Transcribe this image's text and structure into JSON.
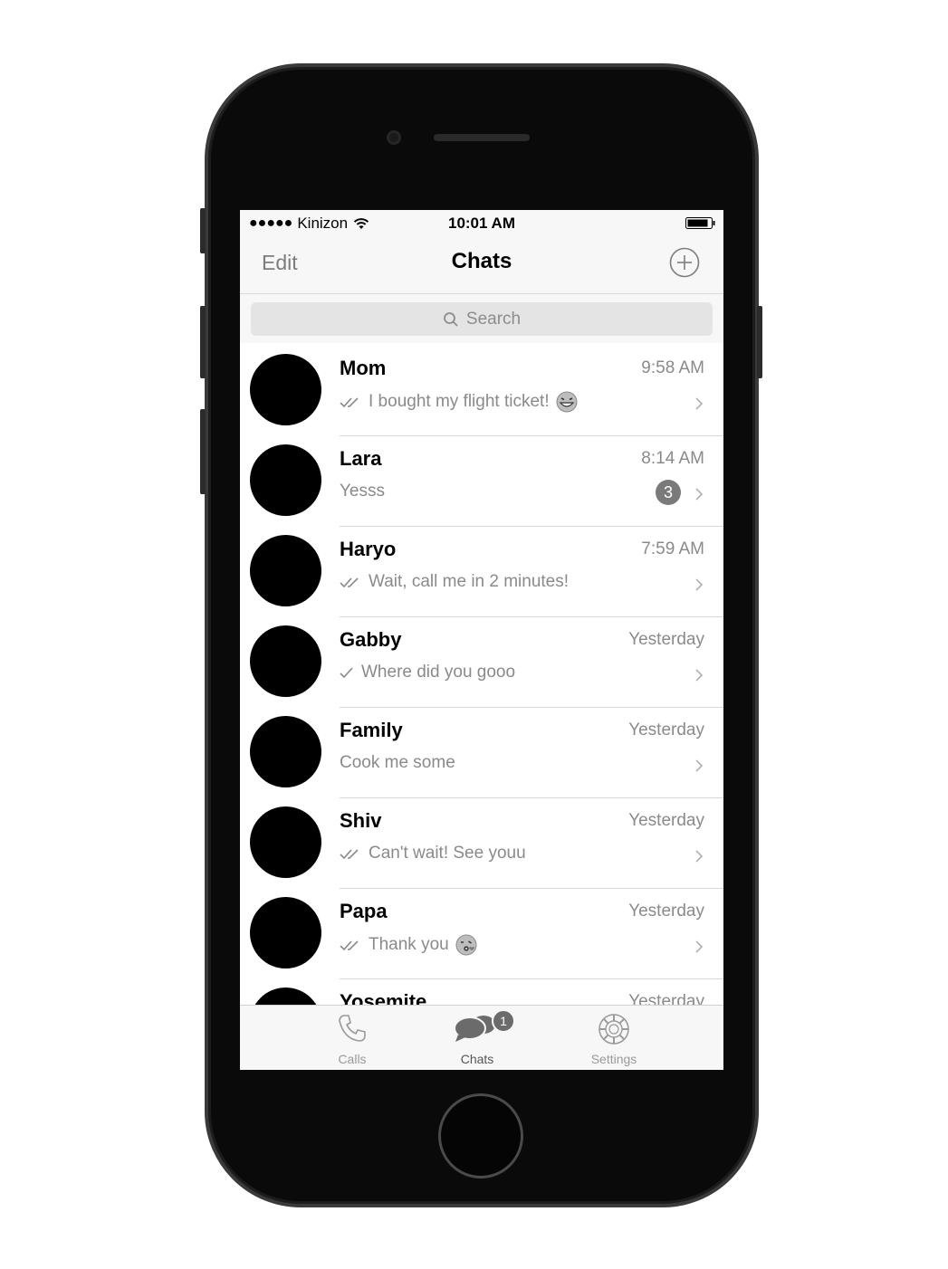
{
  "status_bar": {
    "signal": "●●●●●",
    "carrier": "Kinizon",
    "time": "10:01 AM"
  },
  "nav": {
    "edit_label": "Edit",
    "title": "Chats"
  },
  "search": {
    "placeholder": "Search"
  },
  "chats": [
    {
      "name": "Mom",
      "time": "9:58 AM",
      "preview": "I bought my flight ticket!",
      "status": "read",
      "emoji": "grinning-face"
    },
    {
      "name": "Lara",
      "time": "8:14 AM",
      "preview": "Yesss",
      "status": "none",
      "unread": "3"
    },
    {
      "name": "Haryo",
      "time": "7:59 AM",
      "preview": "Wait, call me in 2 minutes!",
      "status": "read"
    },
    {
      "name": "Gabby",
      "time": "Yesterday",
      "preview": "Where did you gooo",
      "status": "sent"
    },
    {
      "name": "Family",
      "time": "Yesterday",
      "preview": "Cook me some",
      "status": "none"
    },
    {
      "name": "Shiv",
      "time": "Yesterday",
      "preview": "Can't wait! See youu",
      "status": "read"
    },
    {
      "name": "Papa",
      "time": "Yesterday",
      "preview": "Thank you",
      "status": "read",
      "emoji": "kissing-face"
    },
    {
      "name": "Yosemite",
      "time": "Yesterday"
    }
  ],
  "tabs": [
    {
      "label": "Calls",
      "icon": "phone-icon"
    },
    {
      "label": "Chats",
      "icon": "chat-bubbles-icon",
      "badge": "1",
      "active": true
    },
    {
      "label": "Settings",
      "icon": "gear-icon"
    }
  ]
}
